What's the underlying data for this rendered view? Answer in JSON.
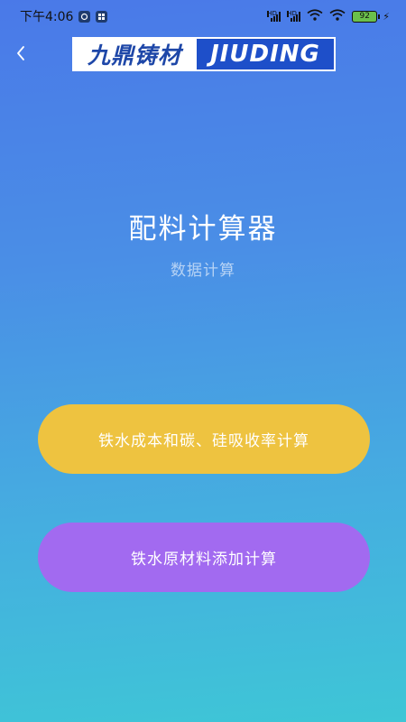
{
  "status_bar": {
    "time": "下午4:06",
    "battery": "92"
  },
  "header": {
    "back_icon": "chevron-left-icon",
    "logo_cn": "九鼎铸材",
    "logo_en": "JIUDING"
  },
  "main": {
    "title": "配料计算器",
    "subtitle": "数据计算",
    "buttons": [
      {
        "label": "铁水成本和碳、硅吸收率计算",
        "color": "#eec340"
      },
      {
        "label": "铁水原材料添加计算",
        "color": "#a26af0"
      }
    ]
  },
  "colors": {
    "gradient_top": "#4a79e8",
    "gradient_bottom": "#3ec6d6"
  }
}
